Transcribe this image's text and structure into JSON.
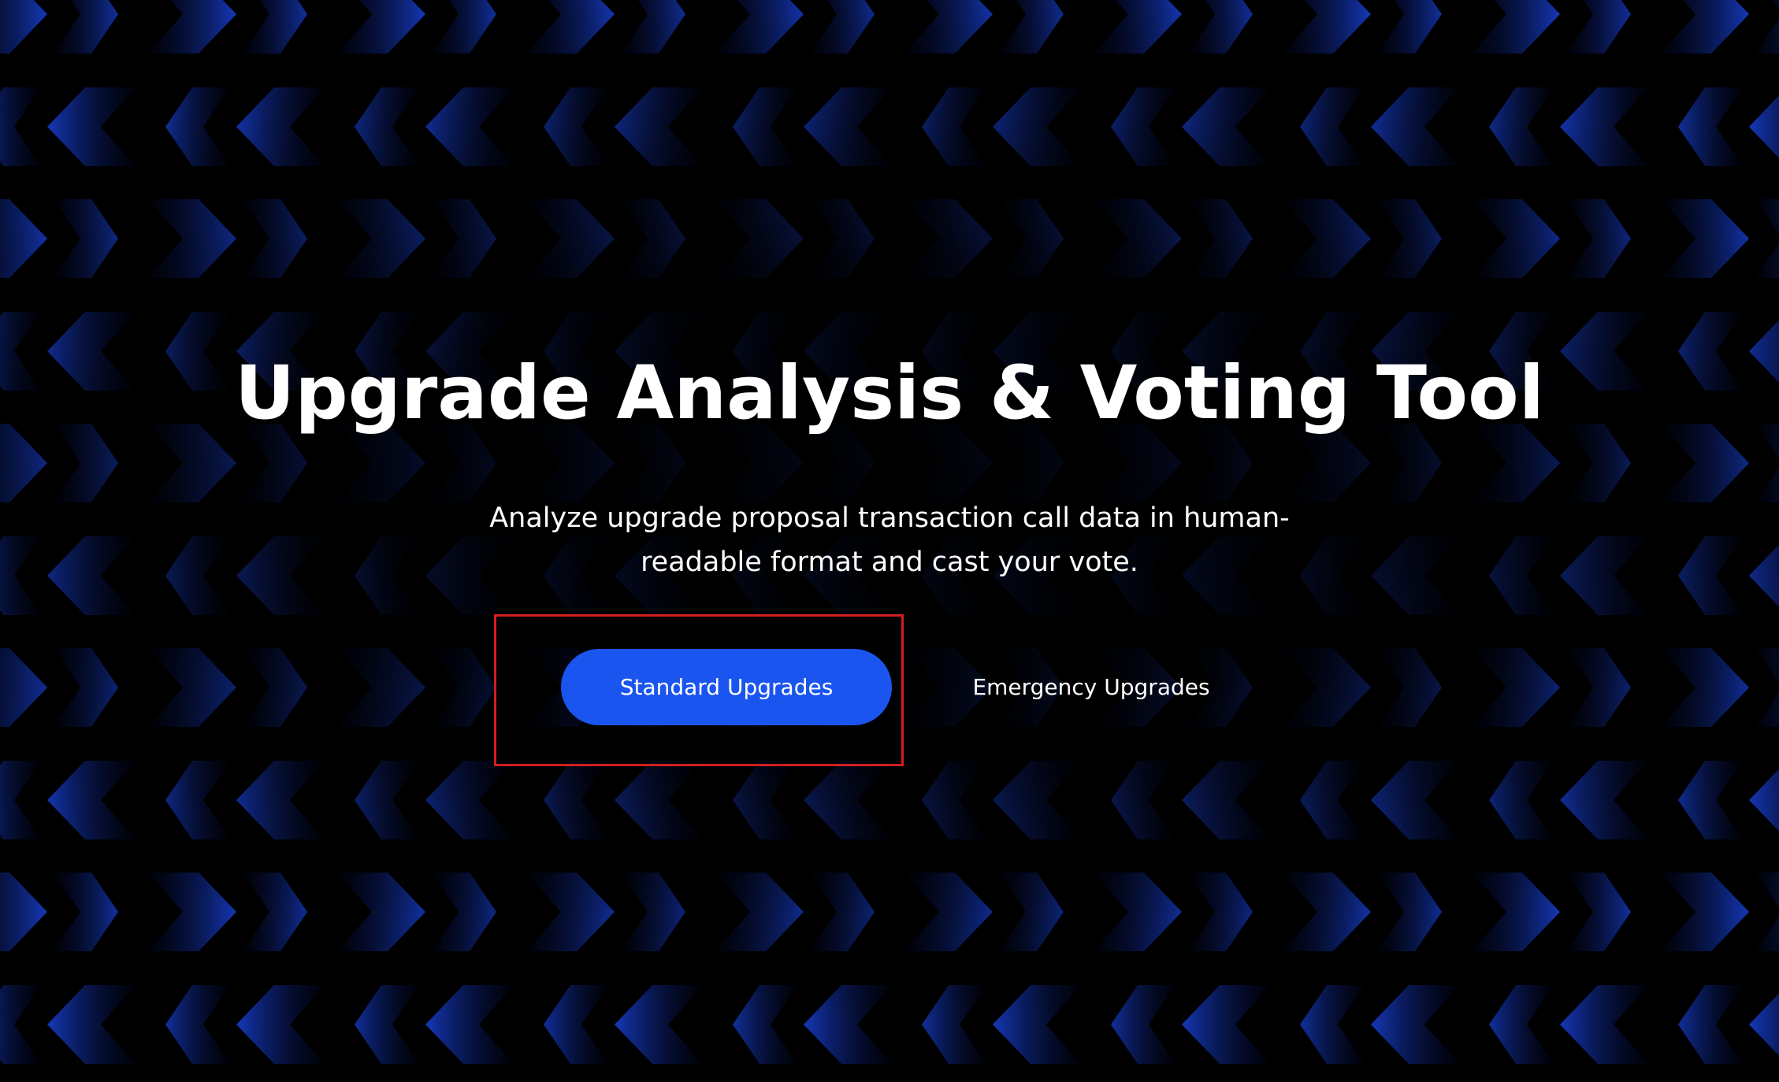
{
  "hero": {
    "title": "Upgrade Analysis & Voting Tool",
    "subtitle": "Analyze upgrade proposal transaction call data in human-readable format and cast your vote."
  },
  "actions": {
    "standard_label": "Standard Upgrades",
    "emergency_label": "Emergency Upgrades"
  },
  "background": {
    "pattern": "arrow-chevron-pattern",
    "base_color": "#000000",
    "accent_color": "#1538b8"
  },
  "colors": {
    "primary_button": "#1a55f0",
    "highlight_outline": "#d11f1f",
    "text": "#ffffff"
  }
}
